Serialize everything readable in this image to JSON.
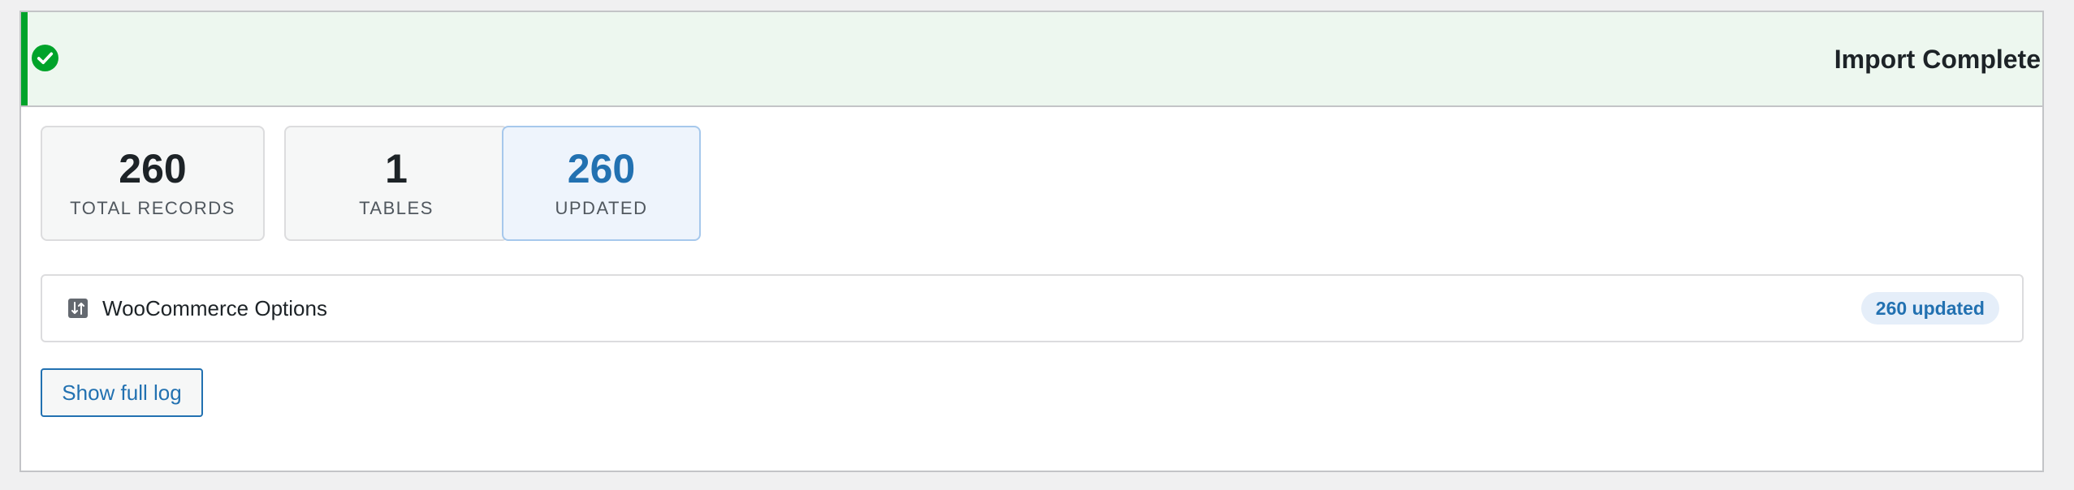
{
  "notice": {
    "title": "Import Complete",
    "icon": "check-circle-icon",
    "accent_color": "#00a32a",
    "background_color": "#edf7ef"
  },
  "stats": [
    {
      "value": "260",
      "label": "TOTAL RECORDS"
    },
    {
      "value": "1",
      "label": "TABLES"
    },
    {
      "value": "260",
      "label": "UPDATED",
      "highlight_color": "#2271b1"
    }
  ],
  "tables": [
    {
      "icon": "import-export-icon",
      "name": "WooCommerce Options",
      "badge": "260 updated"
    }
  ],
  "actions": {
    "show_log_label": "Show full log"
  }
}
